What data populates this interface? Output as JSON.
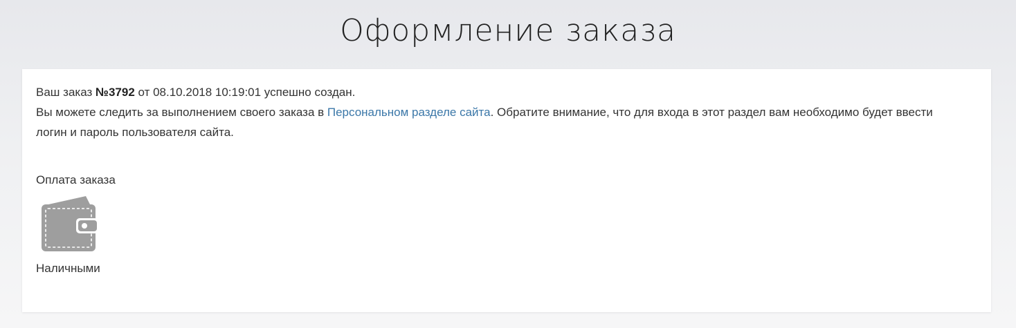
{
  "page": {
    "title": "Оформление заказа"
  },
  "order": {
    "prefix": "Ваш заказ ",
    "number": "№3792",
    "suffix": " от 08.10.2018 10:19:01 успешно создан.",
    "tracking_prefix": "Вы можете следить за выполнением своего заказа в ",
    "personal_link": "Персональном разделе сайта",
    "tracking_suffix": ". Обратите внимание, что для входа в этот раздел вам необходимо будет ввести логин и пароль пользователя сайта."
  },
  "payment": {
    "title": "Оплата заказа",
    "method_icon": "wallet-icon",
    "method_label": "Наличными"
  },
  "colors": {
    "link": "#3b77a8",
    "icon": "#9e9e9e"
  }
}
